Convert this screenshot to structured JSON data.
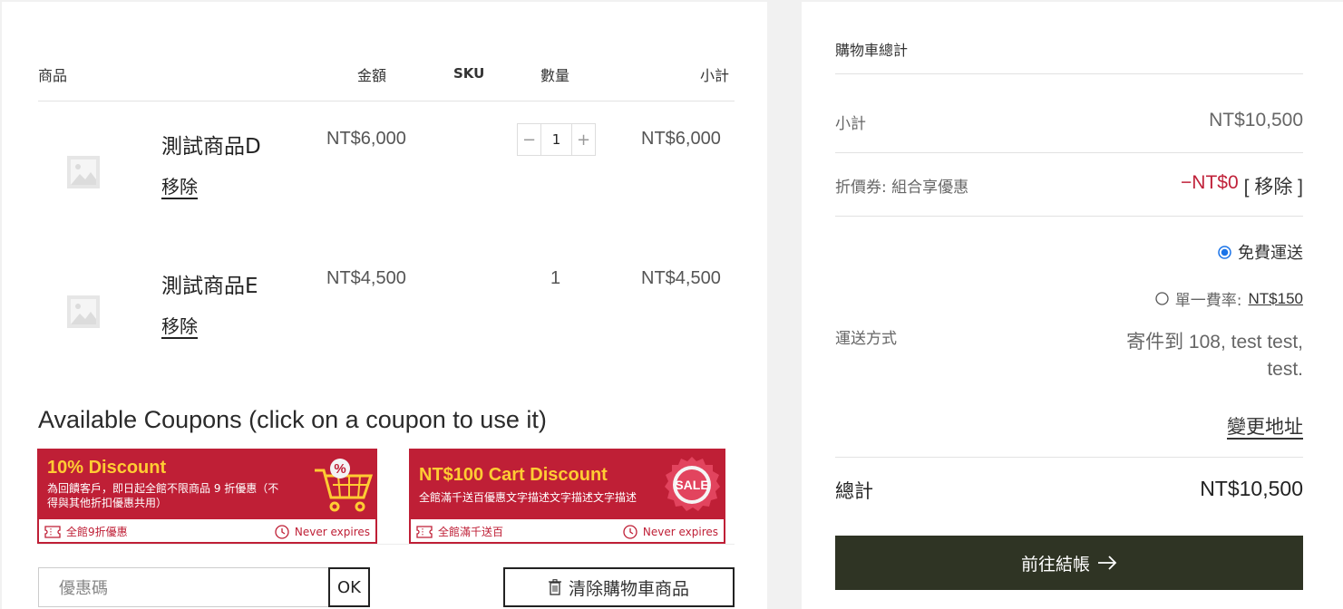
{
  "cart": {
    "headers": {
      "product": "商品",
      "price": "金額",
      "sku": "SKU",
      "quantity": "數量",
      "subtotal": "小計"
    },
    "items": [
      {
        "name": "測試商品D",
        "remove": "移除",
        "price": "NT$6,000",
        "qty": "1",
        "subtotal": "NT$6,000"
      },
      {
        "name": "測試商品E",
        "remove": "移除",
        "price": "NT$4,500",
        "qty": "1",
        "subtotal": "NT$4,500"
      }
    ]
  },
  "coupons": {
    "title": "Available Coupons (click on a coupon to use it)",
    "items": [
      {
        "title": "10% Discount",
        "desc1": "為回饋客戶，即日起全館不限商品 9 折優惠（不",
        "desc2": "得與其他折扣優惠共用）",
        "code": "全館9折優惠",
        "expiry": "Never expires",
        "badge": "%"
      },
      {
        "title": "NT$100 Cart Discount",
        "desc1": "全館滿千送百優惠文字描述文字描述文字描述",
        "code": "全館滿千送百",
        "expiry": "Never expires",
        "badge": "SALE"
      }
    ],
    "input_placeholder": "優惠碼",
    "ok_label": "OK",
    "clear_label": "清除購物車商品"
  },
  "totals": {
    "title": "購物車總計",
    "subtotal_label": "小計",
    "subtotal_value": "NT$10,500",
    "coupon_label": "折價券: 組合享優惠",
    "coupon_value": "−NT$0",
    "coupon_remove": "[ 移除 ]",
    "shipping_label": "運送方式",
    "shipping_free": "免費運送",
    "shipping_flat_label": "單一費率:",
    "shipping_flat_value": "NT$150",
    "ship_to_line1": "寄件到 108, test test,",
    "ship_to_line2": "test.",
    "change_address": "變更地址",
    "total_label": "總計",
    "total_value": "NT$10,500",
    "checkout_label": "前往結帳"
  },
  "colors": {
    "coupon_red": "#bf1f36",
    "coupon_yellow": "#ffcc33",
    "checkout_bg": "#2f3424",
    "discount_red": "#c0223a",
    "radio_blue": "#1a73e8"
  }
}
